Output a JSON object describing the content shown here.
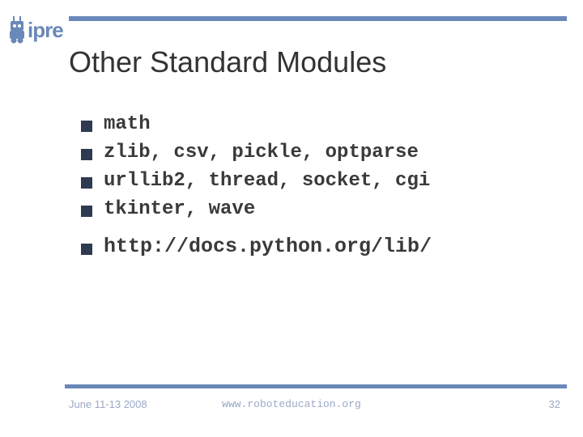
{
  "logo": {
    "word": "ipre"
  },
  "title": "Other Standard Modules",
  "bullets": [
    {
      "text": "math",
      "highlight": false
    },
    {
      "text": "zlib, csv, pickle, optparse",
      "highlight": false
    },
    {
      "text": "urllib2, thread, socket, cgi",
      "highlight": false
    },
    {
      "text": "tkinter, wave",
      "highlight": false
    },
    {
      "text": "http://docs.python.org/lib/",
      "highlight": true
    }
  ],
  "footer": {
    "date": "June 11-13 2008",
    "url": "www.roboteducation.org",
    "page": "32"
  },
  "colors": {
    "accent": "#6a88b8",
    "bullet": "#2d3a52"
  }
}
